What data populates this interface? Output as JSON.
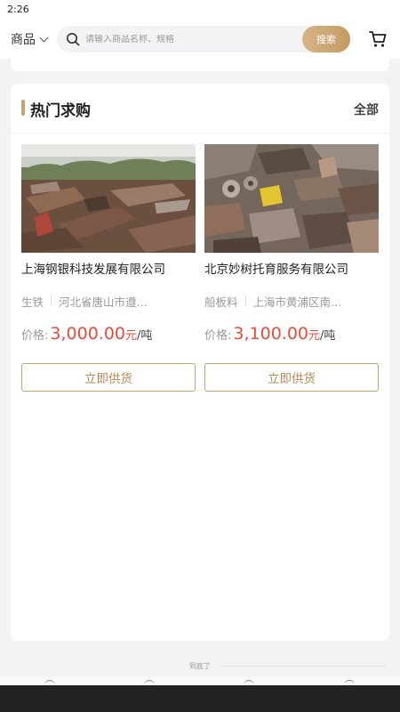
{
  "status_bar": {
    "time": "2:26"
  },
  "top_bar": {
    "category": "商品",
    "search_placeholder": "请输入商品名称、规格",
    "search_button": "搜索",
    "cart_icon": "cart-icon"
  },
  "section": {
    "title": "热门求购",
    "see_all": "全部",
    "accent_color": "#c9a16c"
  },
  "products": [
    {
      "image_icon": "scrap-metal-photo",
      "company": "上海钢银科技发展有限公司",
      "material": "生铁",
      "location": "河北省唐山市遵…",
      "price_label": "价格:",
      "price": "3,000.00",
      "unit": "元",
      "per": "/吨",
      "button": "立即供货"
    },
    {
      "image_icon": "scrap-metal-photo",
      "company": "北京妙树托育服务有限公司",
      "material": "船板料",
      "location": "上海市黄浦区南…",
      "price_label": "价格:",
      "price": "3,100.00",
      "unit": "元",
      "per": "/吨",
      "button": "立即供货"
    }
  ],
  "footer": {
    "end_text": "到底了"
  },
  "colors": {
    "price": "#e84b3c",
    "gold": "#c49a62"
  }
}
